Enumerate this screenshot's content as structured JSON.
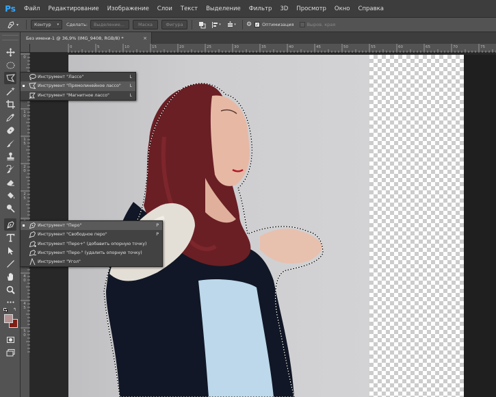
{
  "app": {
    "logo": "Ps",
    "accent_color": "#31a8ff"
  },
  "menu": [
    "Файл",
    "Редактирование",
    "Изображение",
    "Слои",
    "Текст",
    "Выделение",
    "Фильтр",
    "3D",
    "Просмотр",
    "Окно",
    "Справка"
  ],
  "options": {
    "mode_value": "Контур",
    "make_label": "Сделать:",
    "selection_button": "Выделение...",
    "mask_button": "Маска",
    "shape_button": "Фигура",
    "optimization_label": "Оптимизация",
    "optimization_checked": true,
    "align_edges_label": "Выров. края"
  },
  "document": {
    "tab_title": "Без имени-1 @ 36,9% (IMG_9408, RGB/8) *",
    "close_glyph": "×"
  },
  "ruler": {
    "horizontal": [
      "0",
      "5",
      "10",
      "15",
      "20",
      "25",
      "30",
      "35",
      "40",
      "45",
      "50",
      "55",
      "60",
      "65",
      "70",
      "75",
      "80"
    ],
    "vertical": [
      "0",
      "5",
      "1 0",
      "1 5",
      "2 0",
      "2 5",
      "3 0",
      "3 5",
      "4 0",
      "4 5",
      "5 0"
    ]
  },
  "tools": [
    "move-tool",
    "marquee-tool",
    "lasso-tool",
    "magic-wand-tool",
    "crop-tool",
    "eyedropper-tool",
    "healing-brush-tool",
    "brush-tool",
    "clone-stamp-tool",
    "history-brush-tool",
    "eraser-tool",
    "paint-bucket-tool",
    "dodge-tool",
    "pen-tool",
    "type-tool",
    "path-selection-tool",
    "line-tool",
    "hand-tool",
    "zoom-tool",
    "more-tools",
    "colors",
    "quick-mask",
    "screen-mode"
  ],
  "colors": {
    "foreground": "#b59292",
    "background": "#7f1e14"
  },
  "lasso_flyout": {
    "items": [
      {
        "label": "Инструмент \"Лассо\"",
        "key": "L",
        "selected": false
      },
      {
        "label": "Инструмент \"Прямолинейное лассо\"",
        "key": "L",
        "selected": true
      },
      {
        "label": "Инструмент \"Магнитное лассо\"",
        "key": "L",
        "selected": false
      }
    ]
  },
  "pen_flyout": {
    "items": [
      {
        "label": "Инструмент \"Перо\"",
        "key": "P",
        "selected": true
      },
      {
        "label": "Инструмент \"Свободное перо\"",
        "key": "P",
        "selected": false
      },
      {
        "label": "Инструмент \"Перо+\" (добавить опорную точку)",
        "key": "",
        "selected": false
      },
      {
        "label": "Инструмент \"Перо-\" (удалить опорную точку)",
        "key": "",
        "selected": false
      },
      {
        "label": "Инструмент \"Угол\"",
        "key": "",
        "selected": false
      }
    ]
  }
}
